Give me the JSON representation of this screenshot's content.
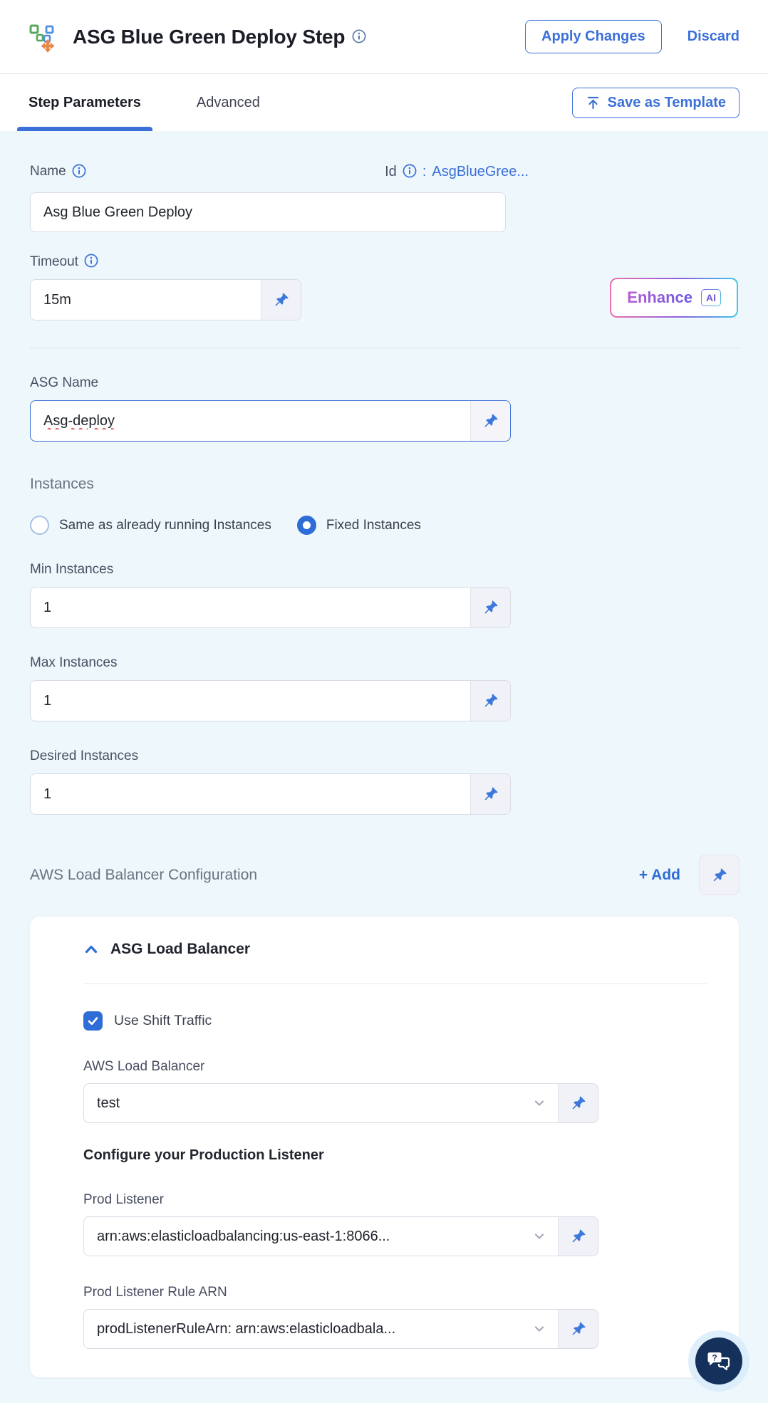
{
  "header": {
    "title": "ASG Blue Green Deploy Step",
    "apply_label": "Apply Changes",
    "discard_label": "Discard"
  },
  "tabs": {
    "step_parameters": "Step Parameters",
    "advanced": "Advanced",
    "save_as_template": "Save as Template"
  },
  "enhance": {
    "label": "Enhance",
    "badge": "AI"
  },
  "form": {
    "name": {
      "label": "Name",
      "value": "Asg Blue Green Deploy"
    },
    "id": {
      "label": "Id",
      "separator": ":",
      "value": "AsgBlueGree..."
    },
    "timeout": {
      "label": "Timeout",
      "value": "15m"
    },
    "asg_name": {
      "label": "ASG Name",
      "value": "Asg-deploy"
    },
    "instances": {
      "heading": "Instances",
      "options": [
        {
          "label": "Same as already running Instances",
          "selected": false
        },
        {
          "label": "Fixed Instances",
          "selected": true
        }
      ],
      "min": {
        "label": "Min Instances",
        "value": "1"
      },
      "max": {
        "label": "Max Instances",
        "value": "1"
      },
      "desired": {
        "label": "Desired Instances",
        "value": "1"
      }
    },
    "lb_config": {
      "heading": "AWS Load Balancer Configuration",
      "add_label": "+ Add",
      "accordion_title": "ASG Load Balancer",
      "use_shift_traffic_label": "Use Shift Traffic",
      "aws_lb": {
        "label": "AWS Load Balancer",
        "value": "test"
      },
      "prod_section_title": "Configure your Production Listener",
      "prod_listener": {
        "label": "Prod Listener",
        "value": "arn:aws:elasticloadbalancing:us-east-1:8066..."
      },
      "prod_listener_rule": {
        "label": "Prod Listener Rule ARN",
        "value": "prodListenerRuleArn: arn:aws:elasticloadbala..."
      }
    }
  },
  "colors": {
    "accent_blue": "#3b70d9",
    "selected_blue": "#2e6cd6",
    "content_bg": "#eef7fc",
    "navy_fab": "#14315c",
    "enhance_gradient_start": "#ee6fae",
    "enhance_gradient_mid": "#8a63e0",
    "enhance_gradient_end": "#42c8e8"
  }
}
